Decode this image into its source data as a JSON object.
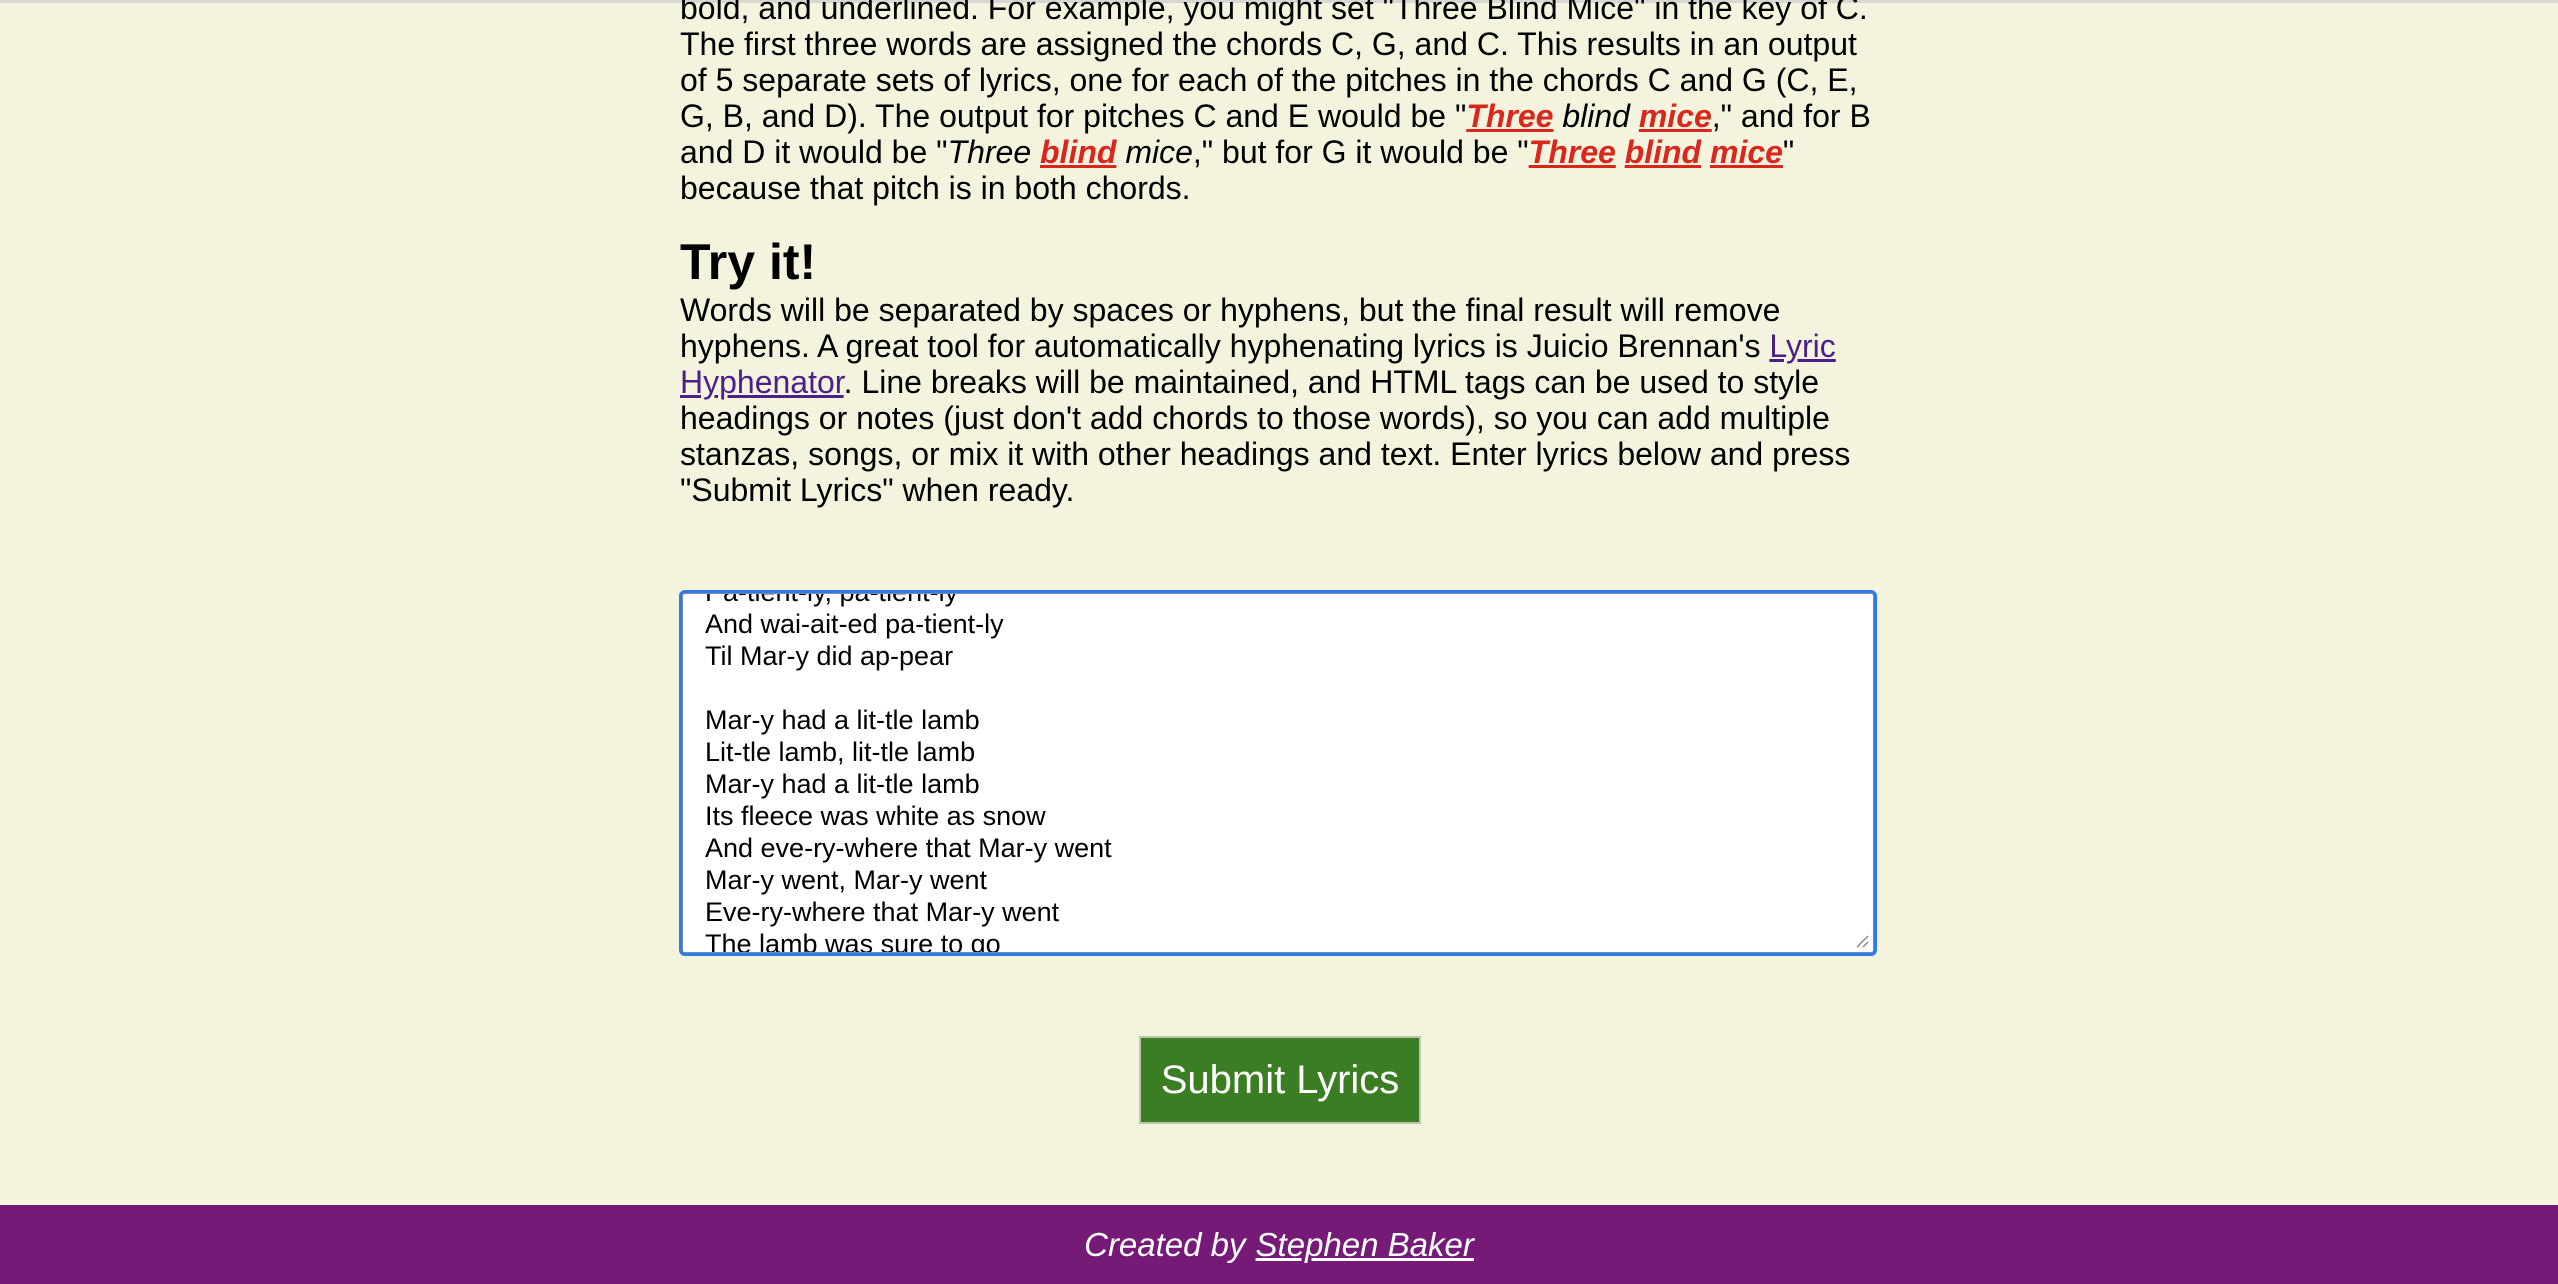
{
  "intro": {
    "line1": "bold, and underlined. For example, you might set \"Three Blind Mice\" in the key of C.",
    "line2": "The first three words are assigned the chords C, G, and C. This results in an output",
    "line3": "of 5 separate sets of lyrics, one for each of the pitches in the chords C and G (C, E,",
    "line4_a": "G, B, and D). The output for pitches C and E would be \"",
    "line4_three": "Three",
    "line4_blind": "blind",
    "line4_mice": "mice",
    "line4_b": ",\" and for B",
    "line5_a": "and D it would be \"",
    "line5_three": "Three",
    "line5_blind": "blind",
    "line5_mice": "mice",
    "line5_b": ",\" but for G it would be \"",
    "line5_three2": "Three",
    "line5_blind2": "blind",
    "line5_mice2": "mice",
    "line5_c": "\"",
    "line6": "because that pitch is in both chords."
  },
  "try_it": {
    "heading": "Try it!",
    "p_a": "Words will be separated by spaces or hyphens, but the final result will remove hyphens. A great tool for automatically hyphenating lyrics is Juicio Brennan's ",
    "link_text": "Lyric Hyphenator",
    "p_b": ". Line breaks will be maintained, and HTML tags can be used to style headings or notes (just don't add chords to those words), so you can add multiple stanzas, songs, or mix it with other headings and text. Enter lyrics below and press \"Submit Lyrics\" when ready."
  },
  "lyrics": {
    "value": "Pa-tient-ly, pa-tient-ly\nAnd wai-ait-ed pa-tient-ly\nTil Mar-y did ap-pear\n\nMar-y had a lit-tle lamb\nLit-tle lamb, lit-tle lamb\nMar-y had a lit-tle lamb\nIts fleece was white as snow\nAnd eve-ry-where that Mar-y went\nMar-y went, Mar-y went\nEve-ry-where that Mar-y went\nThe lamb was sure to go"
  },
  "submit": {
    "label": "Submit Lyrics"
  },
  "footer": {
    "prefix": "Created by",
    "author": "Stephen Baker"
  }
}
